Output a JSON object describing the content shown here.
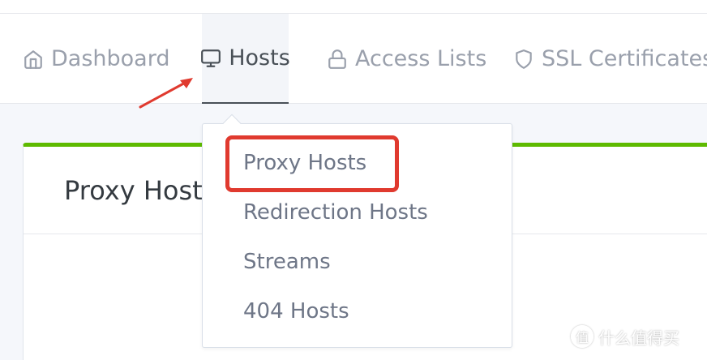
{
  "nav": {
    "items": [
      {
        "label": "Dashboard",
        "icon": "home-icon"
      },
      {
        "label": "Hosts",
        "icon": "monitor-icon",
        "active": true
      },
      {
        "label": "Access Lists",
        "icon": "lock-icon"
      },
      {
        "label": "SSL Certificates",
        "icon": "shield-icon"
      }
    ]
  },
  "dropdown": {
    "items": [
      {
        "label": "Proxy Hosts",
        "highlighted": true
      },
      {
        "label": "Redirection Hosts"
      },
      {
        "label": "Streams"
      },
      {
        "label": "404 Hosts"
      }
    ]
  },
  "card": {
    "title": "Proxy Hosts"
  },
  "watermark": {
    "logo": "值",
    "text": "什么值得买"
  },
  "colors": {
    "accent_green": "#5eba00",
    "annotation_red": "#e03a2f",
    "nav_muted": "#9aa0ac",
    "nav_active": "#495057"
  }
}
